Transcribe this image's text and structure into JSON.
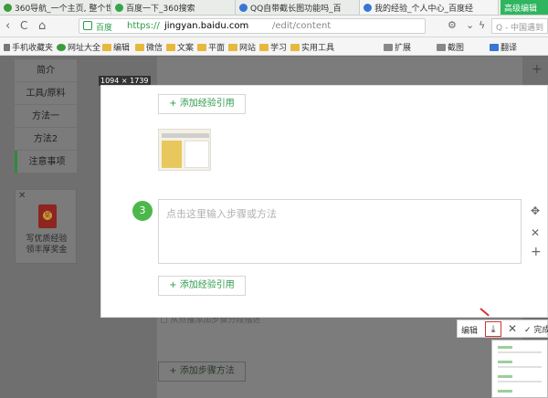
{
  "tabs": [
    {
      "label": "360导航_一个主页, 整个世",
      "color": "#3a9b3a"
    },
    {
      "label": "百度一下_360搜索",
      "color": "#33a64b"
    },
    {
      "label": "QQ自带截长图功能吗_百",
      "color": "#3876d2"
    },
    {
      "label": "我的经验_个人中心_百度经",
      "color": "#3876d2"
    },
    {
      "label": "高级编辑",
      "color": "#ffffff"
    }
  ],
  "address": {
    "back_icon": "back-arrow-icon",
    "refresh_glyph": "C",
    "site_tag": "百度",
    "scheme": "https://",
    "host": "jingyan.baidu.com",
    "path": "/edit/content",
    "search_placeholder": "Q - 中国遇到"
  },
  "bookmarks": [
    "手机收藏夹",
    "网址大全",
    "编辑",
    "微信",
    "文案",
    "平面",
    "网站",
    "学习",
    "实用工具",
    "扩展",
    "截图",
    "翻译"
  ],
  "sidenav": {
    "items": [
      "简介",
      "工具/原料",
      "方法一",
      "方法2",
      "注意事项"
    ],
    "active_index": 4
  },
  "ad": {
    "line1": "写优质经验",
    "line2": "领丰厚奖金"
  },
  "selection": {
    "size_label": "1094 × 1739",
    "add_reference": "+ 添加经验引用",
    "step_number": "3",
    "step_placeholder": "点击这里输入步骤或方法",
    "add_reference_2": "+ 添加经验引用"
  },
  "background": {
    "add_step": "+ 添加步骤方法",
    "hint": "▢ 从点播添加步骤分段描述"
  },
  "capture_toolbar": {
    "edit": "编辑",
    "done": "✓ 完成"
  }
}
